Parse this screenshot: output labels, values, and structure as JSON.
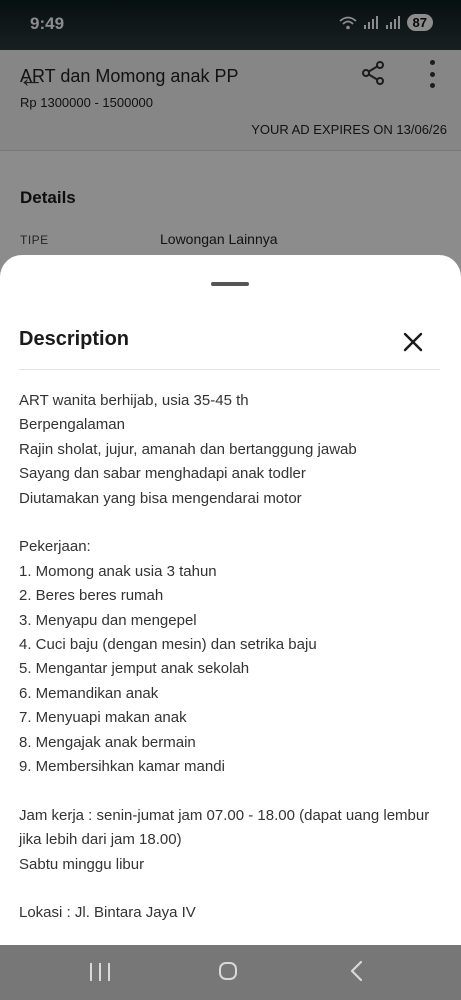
{
  "status_bar": {
    "time": "9:49",
    "battery": "87"
  },
  "header": {
    "title": "ART dan Momong anak PP",
    "price": "Rp 1300000 - 1500000",
    "expiry": "YOUR AD EXPIRES ON 13/06/26"
  },
  "details": {
    "heading": "Details",
    "type_label": "TIPE",
    "type_value": "Lowongan Lainnya"
  },
  "sheet": {
    "title": "Description",
    "lines": [
      "ART wanita berhijab, usia 35-45 th",
      "Berpengalaman",
      "Rajin sholat, jujur, amanah dan bertanggung jawab",
      "Sayang dan sabar menghadapi anak todler",
      "Diutamakan yang bisa mengendarai motor",
      "",
      "Pekerjaan:",
      "1. Momong anak usia 3 tahun",
      "2. Beres beres rumah",
      "3. Menyapu dan mengepel",
      "4. Cuci baju (dengan mesin) dan setrika baju",
      "5. Mengantar jemput anak sekolah",
      "6. Memandikan anak",
      "7. Menyuapi makan anak",
      "8. Mengajak anak bermain",
      "9. Membersihkan kamar mandi",
      "",
      "Jam kerja : senin-jumat jam 07.00 - 18.00 (dapat uang lembur jika lebih dari jam 18.00)",
      "Sabtu minggu libur",
      "",
      "Lokasi : Jl. Bintara Jaya IV"
    ]
  }
}
